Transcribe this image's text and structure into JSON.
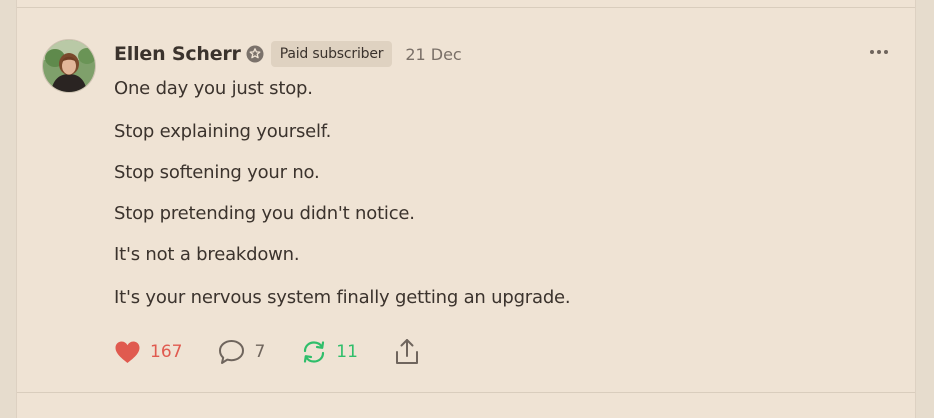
{
  "post": {
    "author": {
      "name": "Ellen Scherr",
      "badge": "Paid subscriber"
    },
    "date": "21 Dec",
    "lines": [
      "One day you just stop.",
      "Stop explaining yourself.",
      "Stop softening your no.",
      "Stop pretending you didn't notice.",
      "It's not a breakdown.",
      "It's your nervous system finally getting an upgrade."
    ],
    "actions": {
      "likes": "167",
      "comments": "7",
      "restacks": "11"
    }
  },
  "icons": {
    "like": "heart-icon",
    "comment": "comment-bubble-icon",
    "restack": "restack-arrows-icon",
    "share": "share-icon",
    "more": "more-dots-icon",
    "badge": "subscriber-badge-icon"
  },
  "colors": {
    "background": "#efe3d4",
    "like": "#e05a4f",
    "restack": "#2fbe6a",
    "muted": "#7a7068",
    "badge_bg": "#dfd2c1"
  }
}
